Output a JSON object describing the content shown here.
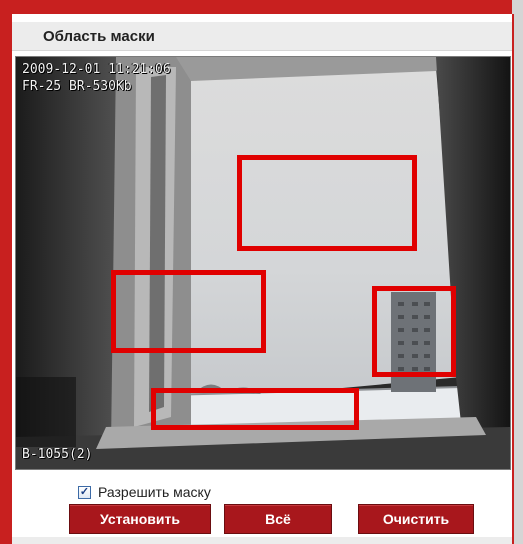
{
  "header": {
    "title": "Область маски"
  },
  "video": {
    "osd_datetime": "2009-12-01 11:21:06",
    "osd_stream": "FR-25 BR-530Kb",
    "osd_camera": "B-1055(2)"
  },
  "mask_regions_count": 4,
  "controls": {
    "enable_mask_label": "Разрешить маску",
    "enable_mask_checked": true,
    "set_button": "Установить",
    "all_button": "Всё",
    "clear_button": "Очистить"
  },
  "colors": {
    "accent": "#c8201f",
    "button": "#a8171c",
    "mask": "#e00000"
  }
}
